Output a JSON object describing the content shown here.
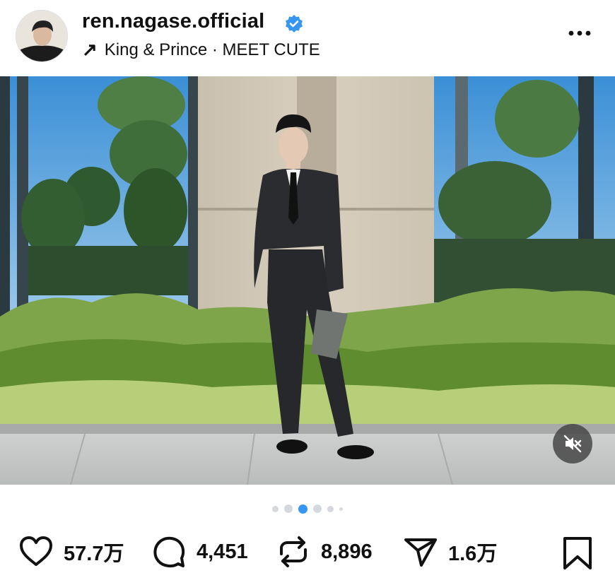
{
  "post": {
    "username": "ren.nagase.official",
    "audio_arrow": "↗",
    "audio_text": "King & Prince · MEET CUTE"
  },
  "carousel": {
    "count": 6,
    "active_index": 2
  },
  "stats": {
    "likes": "57.7万",
    "comments": "4,451",
    "reposts": "8,896",
    "shares": "1.6万"
  },
  "colors": {
    "verified": "#3797f0",
    "active_dot": "#3797f0",
    "inactive_dot": "#d5d9dd"
  },
  "icons": {
    "like": "heart-icon",
    "comment": "comment-icon",
    "repost": "repost-icon",
    "share": "send-icon",
    "save": "bookmark-icon",
    "more": "more-icon",
    "mute": "speaker-muted-icon",
    "audio": "arrow-up-right-icon"
  }
}
